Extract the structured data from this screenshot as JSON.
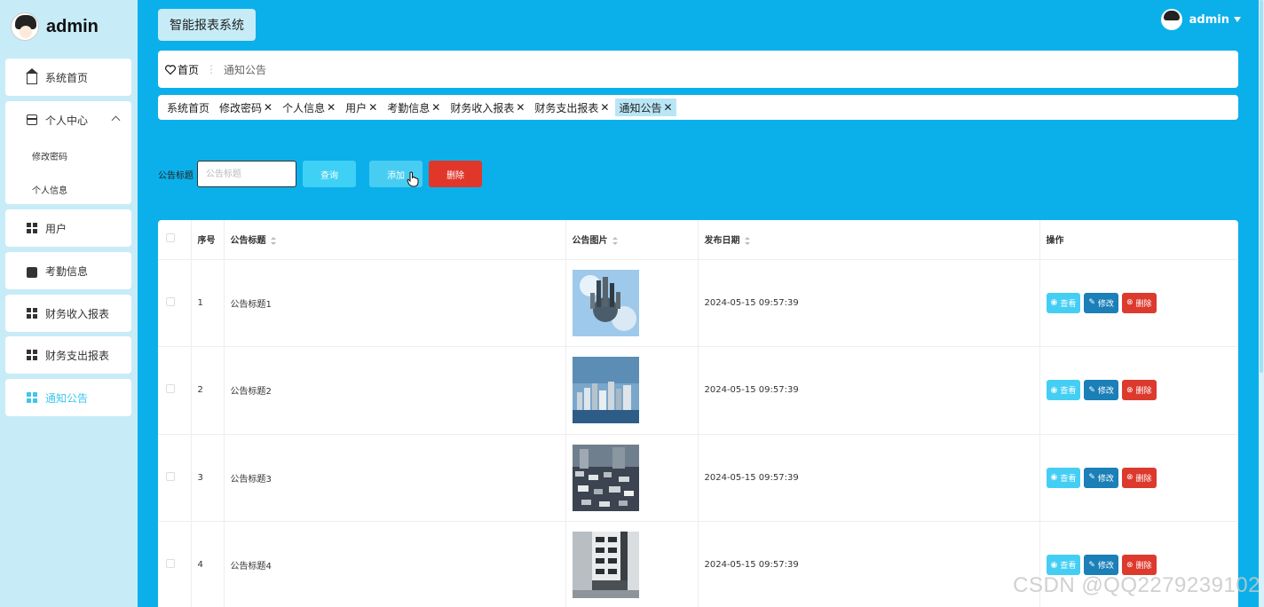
{
  "brand": {
    "name": "admin"
  },
  "header": {
    "system_title": "智能报表系统",
    "user": "admin"
  },
  "sidebar": {
    "items": [
      {
        "label": "系统首页",
        "icon": "home-icon"
      },
      {
        "label": "个人中心",
        "icon": "card-icon"
      },
      {
        "label": "修改密码"
      },
      {
        "label": "个人信息"
      },
      {
        "label": "用户",
        "icon": "grid-icon"
      },
      {
        "label": "考勤信息",
        "icon": "wallet-icon"
      },
      {
        "label": "财务收入报表",
        "icon": "grid-icon"
      },
      {
        "label": "财务支出报表",
        "icon": "grid-icon"
      },
      {
        "label": "通知公告",
        "icon": "grid-icon"
      }
    ]
  },
  "breadcrumb": {
    "home": "首页",
    "current": "通知公告"
  },
  "tags": [
    "系统首页",
    "修改密码",
    "个人信息",
    "用户",
    "考勤信息",
    "财务收入报表",
    "财务支出报表",
    "通知公告"
  ],
  "search": {
    "label": "公告标题",
    "placeholder": "公告标题",
    "query_btn": "查询",
    "add_btn": "添加",
    "delete_btn": "删除"
  },
  "table": {
    "headers": {
      "no": "序号",
      "title": "公告标题",
      "image": "公告图片",
      "date": "发布日期",
      "ops": "操作"
    },
    "rows": [
      {
        "no": "1",
        "title": "公告标题1",
        "date": "2024-05-15 09:57:39"
      },
      {
        "no": "2",
        "title": "公告标题2",
        "date": "2024-05-15 09:57:39"
      },
      {
        "no": "3",
        "title": "公告标题3",
        "date": "2024-05-15 09:57:39"
      },
      {
        "no": "4",
        "title": "公告标题4",
        "date": "2024-05-15 09:57:39"
      }
    ],
    "op_labels": {
      "view": "查看",
      "edit": "修改",
      "delete": "删除"
    }
  },
  "watermark": "CSDN @QQ2279239102",
  "colors": {
    "accent": "#0bb0ea",
    "sidebar_bg": "#c7ecf8",
    "danger": "#e1372b",
    "edit": "#1b7fb8",
    "view": "#45cef4"
  }
}
